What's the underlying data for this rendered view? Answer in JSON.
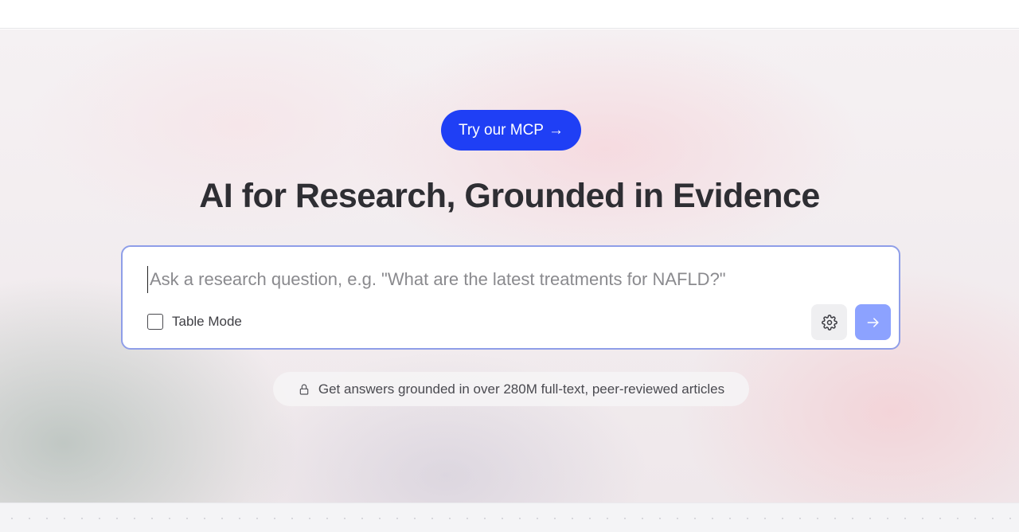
{
  "cta": {
    "label": "Try our MCP",
    "arrow": "→"
  },
  "headline": "AI for Research, Grounded in Evidence",
  "search": {
    "placeholder": "Ask a research question, e.g. \"What are the latest treatments for NAFLD?\"",
    "value": "",
    "table_mode_label": "Table Mode",
    "table_mode_checked": false,
    "settings_icon": "gear-icon",
    "submit_icon": "arrow-right-icon"
  },
  "info": {
    "icon": "lock-icon",
    "text": "Get answers grounded in over 280M full-text, peer-reviewed articles"
  },
  "colors": {
    "accent": "#1f3ff5",
    "submit": "#8ca2ff",
    "border": "#8f9ee8",
    "headline": "#2e2e33"
  }
}
